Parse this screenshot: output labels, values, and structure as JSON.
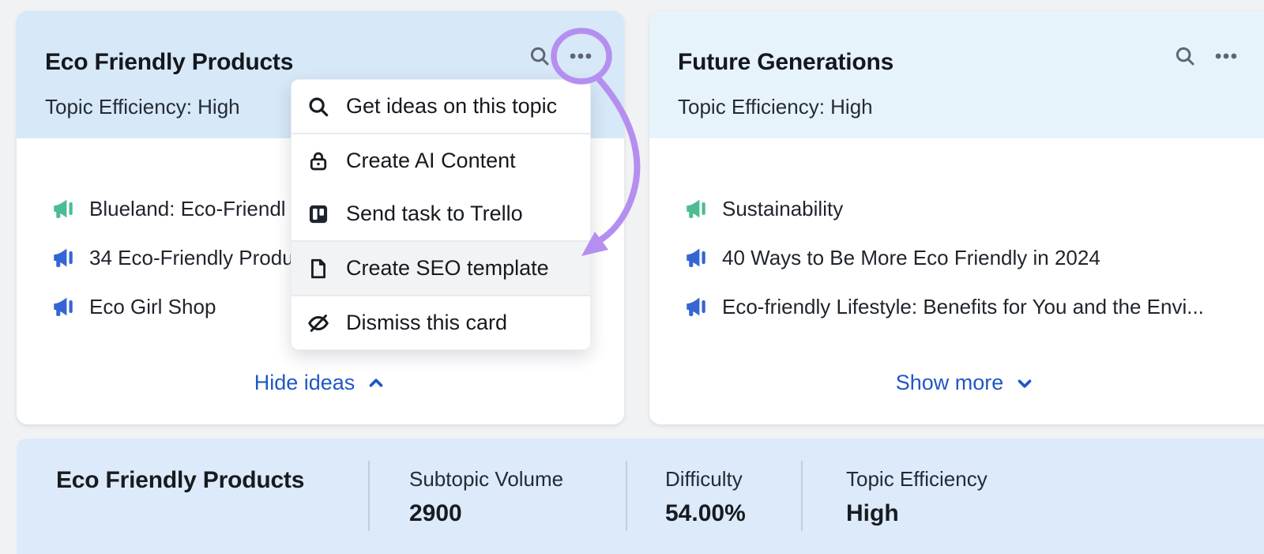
{
  "colors": {
    "accent_link": "#2157c4",
    "megaphone_green": "#4dbc92",
    "megaphone_blue": "#3565d4",
    "annotation_purple": "#b48ff0",
    "selected_header_bg": "#d7e8f8",
    "header_bg": "#e7f3fb",
    "summary_bar_bg": "#dceafa"
  },
  "cards": [
    {
      "title": "Eco Friendly Products",
      "subtitle": "Topic Efficiency: High",
      "items": [
        {
          "text": "Blueland: Eco-Friendl",
          "icon": "green"
        },
        {
          "text": "34 Eco-Friendly Produ",
          "icon": "blue"
        },
        {
          "text": "Eco Girl Shop",
          "icon": "blue"
        }
      ],
      "footer_link": {
        "label": "Hide ideas",
        "chevron": "up"
      }
    },
    {
      "title": "Future Generations",
      "subtitle": "Topic Efficiency: High",
      "items": [
        {
          "text": "Sustainability",
          "icon": "green"
        },
        {
          "text": "40 Ways to Be More Eco Friendly in 2024",
          "icon": "blue"
        },
        {
          "text": "Eco-friendly Lifestyle: Benefits for You and the Envi...",
          "icon": "blue"
        }
      ],
      "footer_link": {
        "label": "Show more",
        "chevron": "down"
      }
    }
  ],
  "menu": {
    "items": [
      {
        "label": "Get ideas on this topic",
        "icon": "search",
        "highlighted": false
      },
      {
        "label": "Create AI Content",
        "icon": "lock",
        "highlighted": false
      },
      {
        "label": "Send task to Trello",
        "icon": "trello",
        "highlighted": false
      },
      {
        "label": "Create SEO template",
        "icon": "document",
        "highlighted": true
      },
      {
        "label": "Dismiss this card",
        "icon": "eye-off",
        "highlighted": false
      }
    ]
  },
  "summary_bar": {
    "title": "Eco Friendly Products",
    "stats": [
      {
        "label": "Subtopic Volume",
        "value": "2900"
      },
      {
        "label": "Difficulty",
        "value": "54.00%"
      },
      {
        "label": "Topic Efficiency",
        "value": "High"
      }
    ]
  }
}
